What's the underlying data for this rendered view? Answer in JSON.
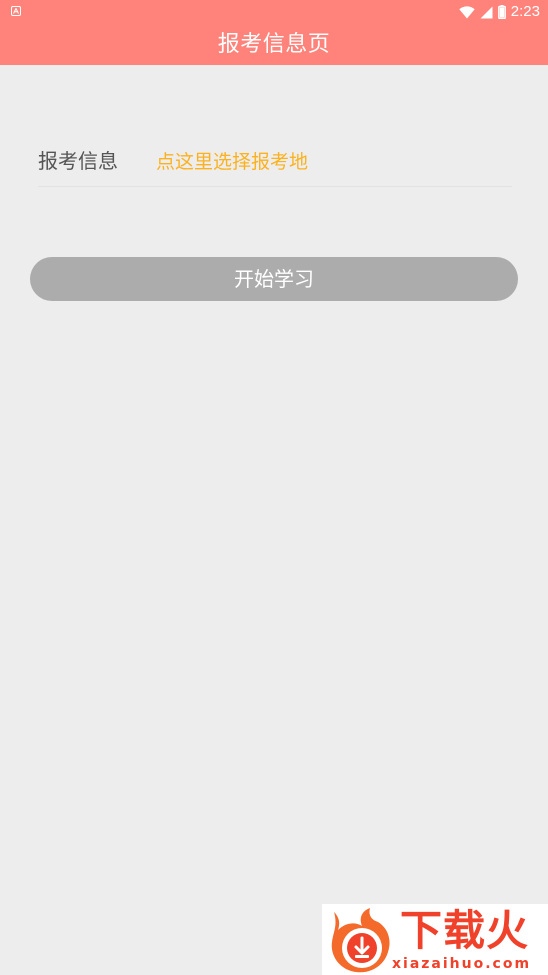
{
  "status_bar": {
    "time": "2:23",
    "icons": [
      "notification-a-icon",
      "wifi-icon",
      "signal-icon",
      "battery-icon"
    ]
  },
  "app_bar": {
    "title": "报考信息页"
  },
  "form": {
    "label": "报考信息",
    "value": "点这里选择报考地"
  },
  "start_button": {
    "label": "开始学习"
  },
  "watermark": {
    "brand": "下载火",
    "url": "xiazaihuo.com"
  },
  "colors": {
    "accent": "#ff837b",
    "value_text": "#fbb21e",
    "button_disabled": "#acacac",
    "background": "#eeedee"
  }
}
